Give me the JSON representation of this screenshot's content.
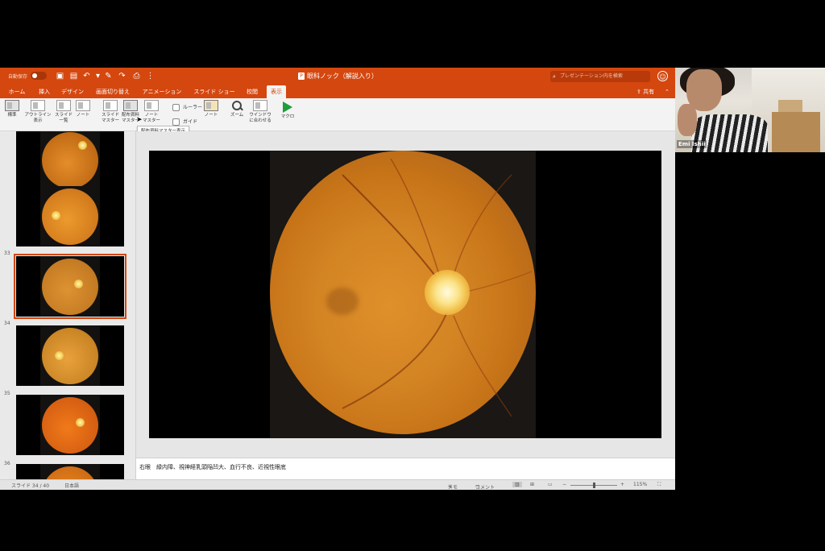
{
  "titlebar": {
    "autosave_label": "自動保存",
    "autosave_state": "オフ",
    "document_title": "眼科ノック（解説入り）",
    "search_placeholder": "プレゼンテーション内を検索"
  },
  "ribbon_tabs": [
    {
      "label": "ホーム"
    },
    {
      "label": "挿入"
    },
    {
      "label": "デザイン"
    },
    {
      "label": "画面切り替え"
    },
    {
      "label": "アニメーション"
    },
    {
      "label": "スライド ショー"
    },
    {
      "label": "校閲"
    },
    {
      "label": "表示"
    }
  ],
  "active_tab": "表示",
  "share_label": "共有",
  "ribbon": {
    "normal": "標準",
    "outline_l1": "アウトライン",
    "outline_l2": "表示",
    "sorter_l1": "スライド",
    "sorter_l2": "一覧",
    "notes_page": "ノート",
    "slide_master_l1": "スライド",
    "slide_master_l2": "マスター",
    "handout_master_l1": "配布資料",
    "handout_master_l2": "マスター",
    "notes_master_l1": "ノート",
    "notes_master_l2": "マスター",
    "ruler": "ルーラー",
    "guides": "ガイド",
    "notes": "ノート",
    "zoom": "ズーム",
    "fit_window_l1": "ウインドウ",
    "fit_window_l2": "に合わせる",
    "macro": "マクロ"
  },
  "tooltip": "配布資料マスター表示",
  "thumbnails": [
    {
      "number": "",
      "selected": false
    },
    {
      "number": "33",
      "selected": false
    },
    {
      "number": "34",
      "selected": true
    },
    {
      "number": "35",
      "selected": false
    },
    {
      "number": "36",
      "selected": false
    },
    {
      "number": "37",
      "selected": false
    }
  ],
  "notes_text": "右眼　緑内障、視神経乳頭陥凹大、血行不良、近視性眼底",
  "statusbar": {
    "slide_indicator": "スライド 34 / 40",
    "language": "日本語",
    "notes_btn": "メモ",
    "comments_btn": "コメント",
    "zoom_level": "115%"
  },
  "webcam": {
    "participant_name": "Emi Ishii"
  },
  "colors": {
    "accent": "#d4470f",
    "macro_play": "#1e9e3c"
  }
}
